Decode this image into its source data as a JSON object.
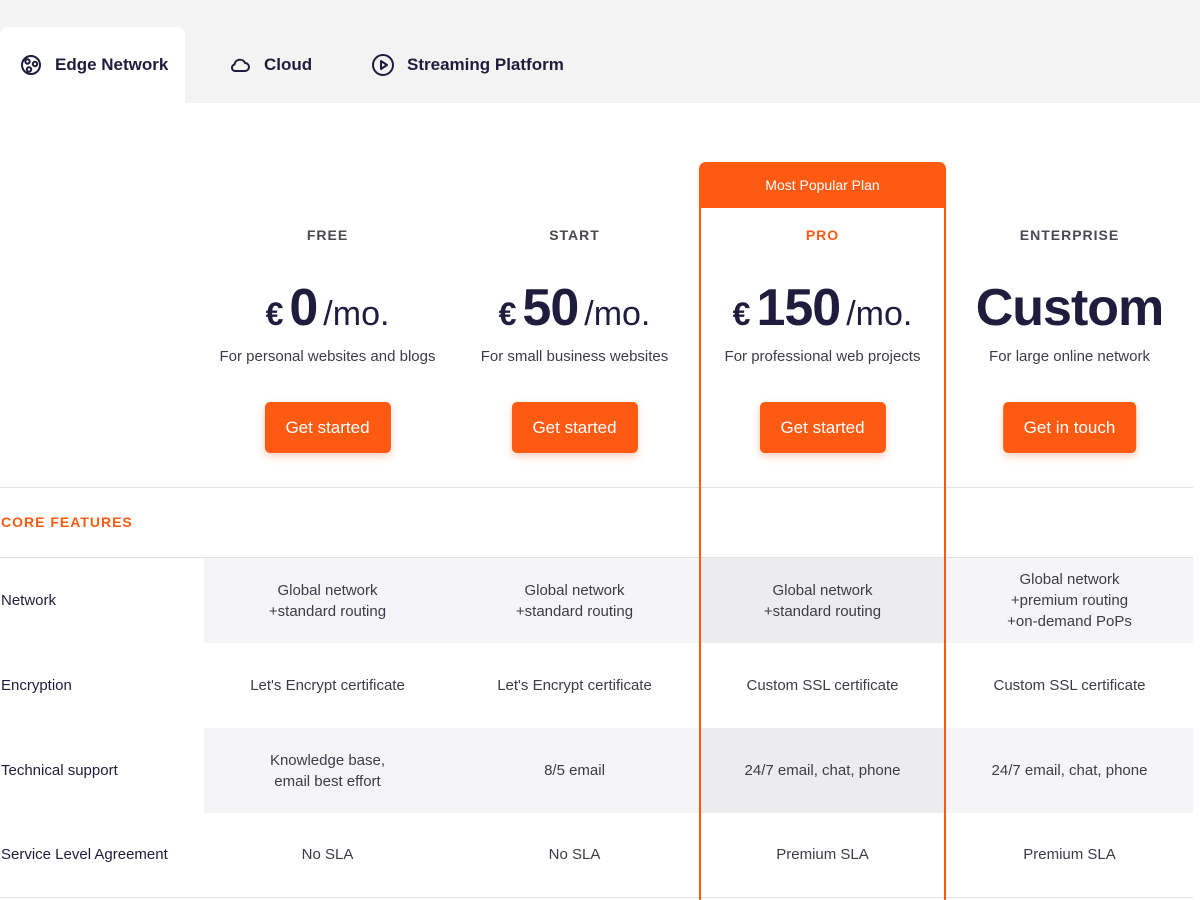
{
  "colors": {
    "accent": "#ff5a12",
    "text": "#1f1d3d",
    "tabbar_bg": "#f3f3f4",
    "row_bg": "#f5f5f7"
  },
  "tabs": [
    {
      "label": "Edge Network",
      "icon": "edge-network-icon",
      "active": true
    },
    {
      "label": "Cloud",
      "icon": "cloud-icon",
      "active": false
    },
    {
      "label": "Streaming Platform",
      "icon": "play-circle-icon",
      "active": false
    }
  ],
  "pro_badge": "Most Popular Plan",
  "plans": [
    {
      "name": "FREE",
      "currency": "€",
      "amount": "0",
      "period": "/mo.",
      "description": "For personal websites and blogs",
      "cta": "Get started"
    },
    {
      "name": "START",
      "currency": "€",
      "amount": "50",
      "period": "/mo.",
      "description": "For small business websites",
      "cta": "Get started"
    },
    {
      "name": "PRO",
      "currency": "€",
      "amount": "150",
      "period": "/mo.",
      "description": "For professional web projects",
      "cta": "Get started"
    },
    {
      "name": "ENTERPRISE",
      "amount": "Custom",
      "description": "For large online network",
      "cta": "Get in touch"
    }
  ],
  "section_title": "CORE FEATURES",
  "features": [
    {
      "label": "Network",
      "values": [
        [
          "Global network",
          "+standard routing"
        ],
        [
          "Global network",
          "+standard routing"
        ],
        [
          "Global network",
          "+standard routing"
        ],
        [
          "Global network",
          "+premium routing",
          "+on-demand PoPs"
        ]
      ]
    },
    {
      "label": "Encryption",
      "values": [
        [
          "Let's Encrypt certificate"
        ],
        [
          "Let's Encrypt certificate"
        ],
        [
          "Custom SSL certificate"
        ],
        [
          "Custom SSL certificate"
        ]
      ]
    },
    {
      "label": "Technical support",
      "values": [
        [
          "Knowledge base,",
          "email best effort"
        ],
        [
          "8/5 email"
        ],
        [
          "24/7 email, chat, phone"
        ],
        [
          "24/7 email, chat, phone"
        ]
      ]
    },
    {
      "label": "Service Level Agreement",
      "values": [
        [
          "No SLA"
        ],
        [
          "No SLA"
        ],
        [
          "Premium SLA"
        ],
        [
          "Premium SLA"
        ]
      ]
    }
  ]
}
